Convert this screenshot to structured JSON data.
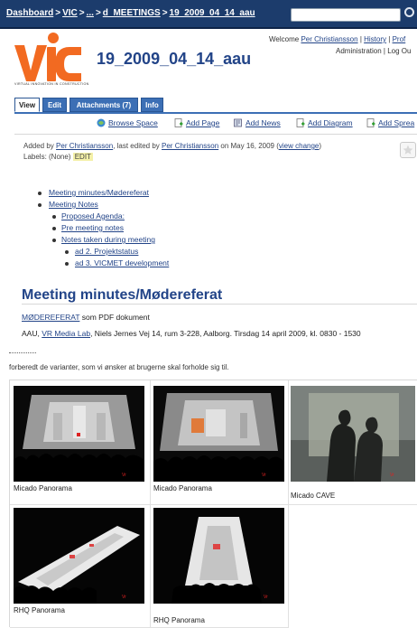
{
  "breadcrumb": {
    "items": [
      "Dashboard",
      "VIC",
      "...",
      "d_MEETINGS",
      "19_2009_04_14_aau"
    ],
    "separator": ">"
  },
  "header": {
    "logo_tagline": "VIRTUAL INNOVATION IN CONSTRUCTION",
    "page_title": "19_2009_04_14_aau",
    "welcome_text": "Welcome",
    "user_name": "Per Christiansson",
    "pipe": "|",
    "history_link": "History",
    "profile_link": "Prof",
    "administration_link": "Administration",
    "logout_link": "Log Ou"
  },
  "tabs": [
    {
      "label": "View",
      "active": true
    },
    {
      "label": "Edit",
      "active": false
    },
    {
      "label": "Attachments (7)",
      "active": false
    },
    {
      "label": "Info",
      "active": false
    }
  ],
  "actions": [
    {
      "label": "Browse Space",
      "icon": "browse-space-icon"
    },
    {
      "label": "Add Page",
      "icon": "add-page-icon"
    },
    {
      "label": "Add News",
      "icon": "add-news-icon"
    },
    {
      "label": "Add Diagram",
      "icon": "add-diagram-icon"
    },
    {
      "label": "Add Sprea",
      "icon": "add-spreadsheet-icon"
    }
  ],
  "meta": {
    "added_by_prefix": "Added by",
    "added_by_user": "Per Christiansson",
    "last_edited_prefix": ", last edited by",
    "last_edited_user": "Per Christiansson",
    "date_text": "on May 16, 2009",
    "view_change_open": "(",
    "view_change": "view change",
    "view_change_close": ")",
    "labels_text": "Labels: (None)",
    "labels_edit": "EDIT"
  },
  "toc": [
    {
      "label": "Meeting minutes/Mødereferat",
      "level": 1
    },
    {
      "label": "Meeting Notes",
      "level": 1
    },
    {
      "label": "Proposed Agenda:",
      "level": 2
    },
    {
      "label": "Pre meeting notes",
      "level": 2
    },
    {
      "label": "Notes taken during meeting",
      "level": 2
    },
    {
      "label": "ad 2. Projektstatus",
      "level": 3
    },
    {
      "label": "ad 3. VICMET development",
      "level": 3
    }
  ],
  "content": {
    "heading": "Meeting minutes/Mødereferat",
    "pdf_link": "MØDEREFERAT",
    "pdf_suffix": " som PDF dokument",
    "venue_prefix": "AAU, ",
    "venue_link": "VR Media Lab",
    "venue_suffix": ", Niels Jernes Vej 14, rum 3-228, Aalborg.  Tirsdag 14 april 2009,  kl. 0830 - 1530",
    "cut_text": "forberedt de varianter, som vi ønsker at brugerne skal forholde sig til."
  },
  "gallery": [
    {
      "caption": "Micado Panorama",
      "kind": "panorama"
    },
    {
      "caption": "Micado Panorama",
      "kind": "panorama-orange"
    },
    {
      "caption": "Micado CAVE",
      "kind": "cave"
    },
    {
      "caption": "RHQ Panorama",
      "kind": "rhq"
    },
    {
      "caption": "RHQ Panorama",
      "kind": "rhq2"
    }
  ],
  "colors": {
    "topbar": "#1c3c6c",
    "link": "#224488",
    "tab_blue": "#3c6fb5",
    "logo_orange": "#f26a21"
  }
}
